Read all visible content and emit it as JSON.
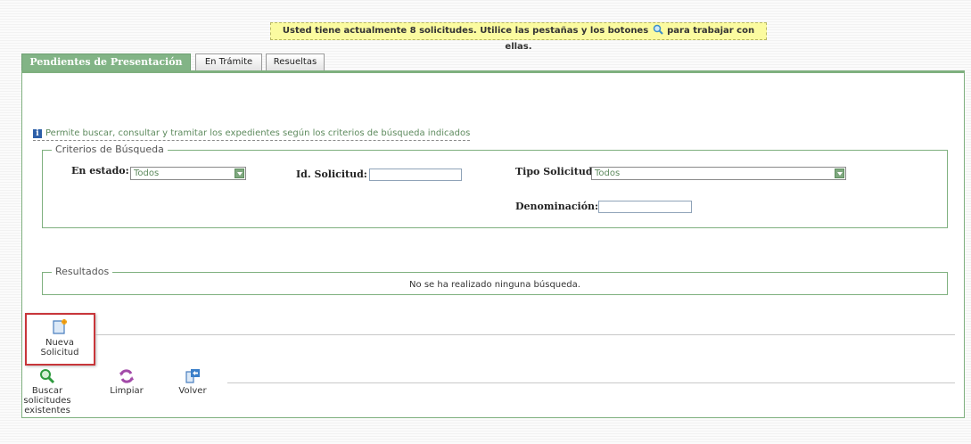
{
  "notice": {
    "text_before": "Usted tiene actualmente 8 solicitudes. Utilice las pestañas y los botones",
    "text_after": "para trabajar con ellas."
  },
  "tabs": [
    {
      "label": "Pendientes de Presentación",
      "active": true
    },
    {
      "label": "En Trámite",
      "active": false
    },
    {
      "label": "Resueltas",
      "active": false
    }
  ],
  "info_text": "Permite buscar, consultar y tramitar los expedientes según los criterios de búsqueda indicados",
  "criterios": {
    "legend": "Criterios de Búsqueda",
    "estado_label": "En estado:",
    "estado_value": "Todos",
    "id_label": "Id. Solicitud:",
    "id_value": "",
    "tipo_label": "Tipo Solicitud:",
    "tipo_value": "Todos",
    "denominacion_label": "Denominación:",
    "denominacion_value": ""
  },
  "resultados": {
    "legend": "Resultados",
    "empty_text": "No se ha realizado ninguna búsqueda."
  },
  "buttons": {
    "nueva_line1": "Nueva",
    "nueva_line2": "Solicitud",
    "buscar_line1": "Buscar",
    "buscar_line2": "solicitudes",
    "buscar_line3": "existentes",
    "limpiar": "Limpiar",
    "volver": "Volver"
  },
  "colors": {
    "accent_green": "#7fb07f",
    "notice_bg": "#fbfba0",
    "highlight_red": "#c8363a"
  },
  "icons": {
    "notice": "search-icon",
    "info": "info-icon",
    "nueva": "new-document-icon",
    "buscar": "search-icon",
    "limpiar": "refresh-icon",
    "volver": "back-icon"
  }
}
